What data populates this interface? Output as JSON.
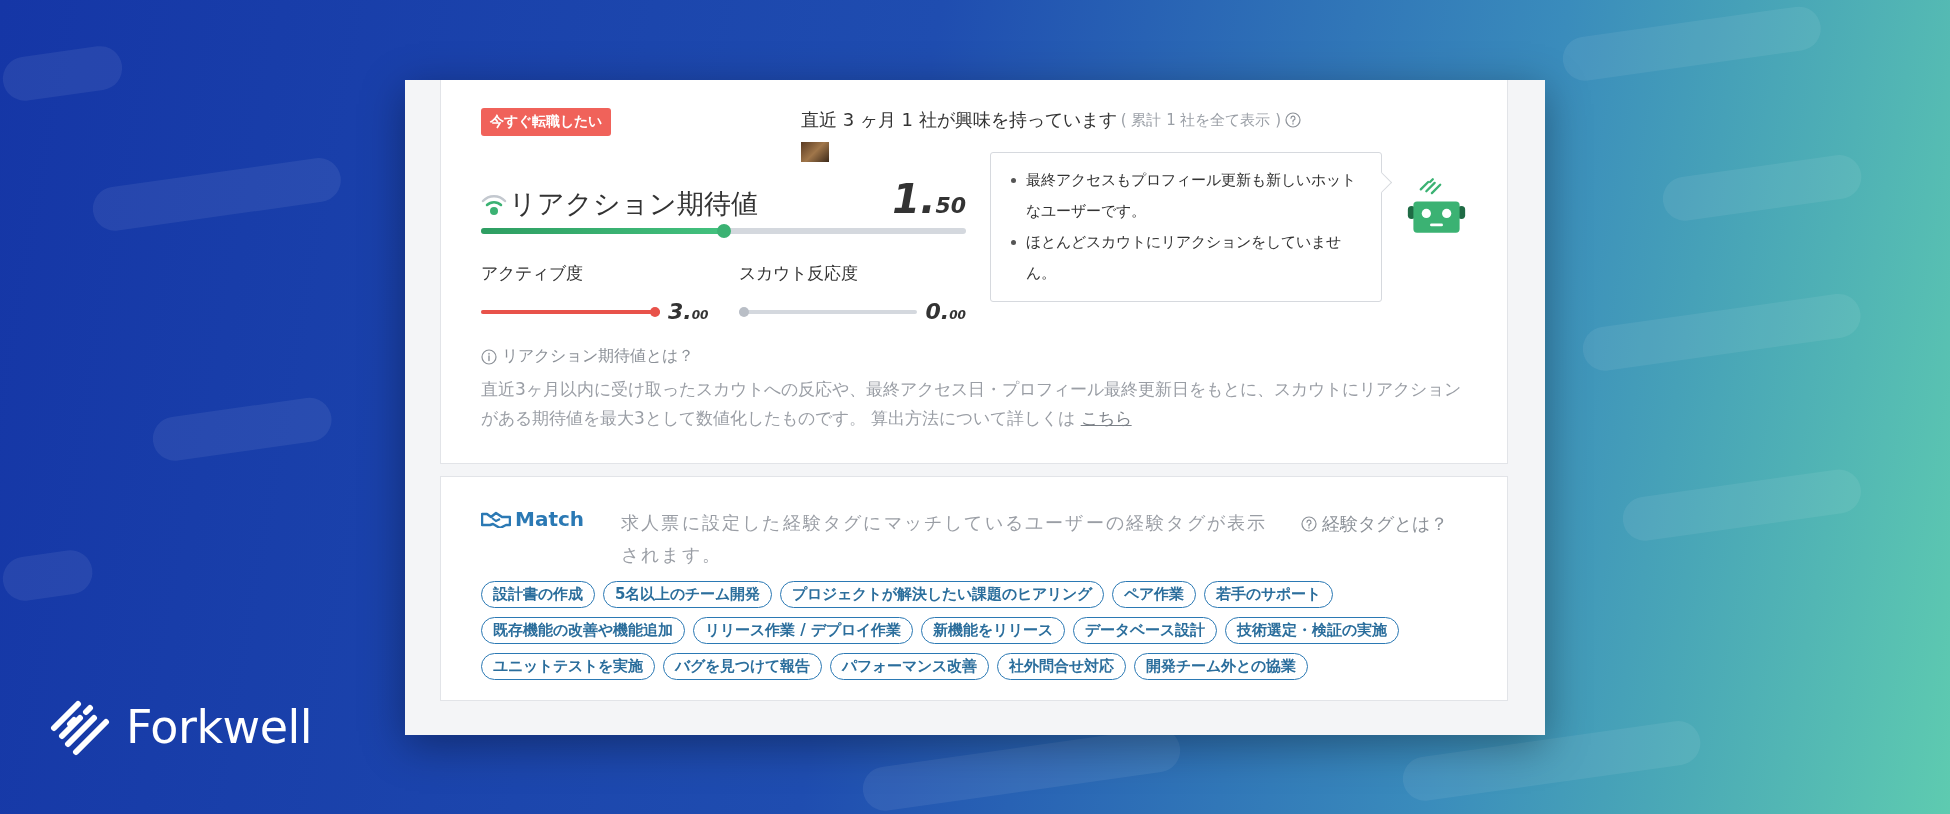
{
  "status_badge": "今すぐ転職したい",
  "interest": {
    "text": "直近 3 ヶ月 1 社が興味を持っています",
    "link": "( 累計 1 社を全て表示 )"
  },
  "reaction": {
    "title": "リアクション期待値",
    "score": "1.50",
    "level": 0.5
  },
  "sub_scores": [
    {
      "label": "アクティブ度",
      "score": "3.00",
      "level": 1,
      "color": "#e8524a"
    },
    {
      "label": "スカウト反応度",
      "score": "0.00",
      "level": 0,
      "color": "#b9bec6"
    }
  ],
  "comments": [
    "最終アクセスもプロフィール更新も新しいホットなユーザーです。",
    "ほとんどスカウトにリアクションをしていません。"
  ],
  "help": {
    "title": "リアクション期待値とは？",
    "text": "直近3ヶ月以内に受け取ったスカウトへの反応や、最終アクセス日・プロフィール最終更新日をもとに、スカウトにリアクションがある期待値を最大3として数値化したものです。 算出方法について詳しくは",
    "link": "こちら"
  },
  "match": {
    "label": "Match",
    "description": "求人票に設定した経験タグにマッチしているユーザーの経験タグが表示されます。",
    "help": "経験タグとは？",
    "tags": [
      "設計書の作成",
      "5名以上のチーム開発",
      "プロジェクトが解決したい課題のヒアリング",
      "ペア作業",
      "若手のサポート",
      "既存機能の改善や機能追加",
      "リリース作業 / デプロイ作業",
      "新機能をリリース",
      "データベース設計",
      "技術選定・検証の実施",
      "ユニットテストを実施",
      "バグを見つけて報告",
      "パフォーマンス改善",
      "社外問合せ対応",
      "開発チーム外との協業"
    ]
  },
  "brand": "Forkwell"
}
